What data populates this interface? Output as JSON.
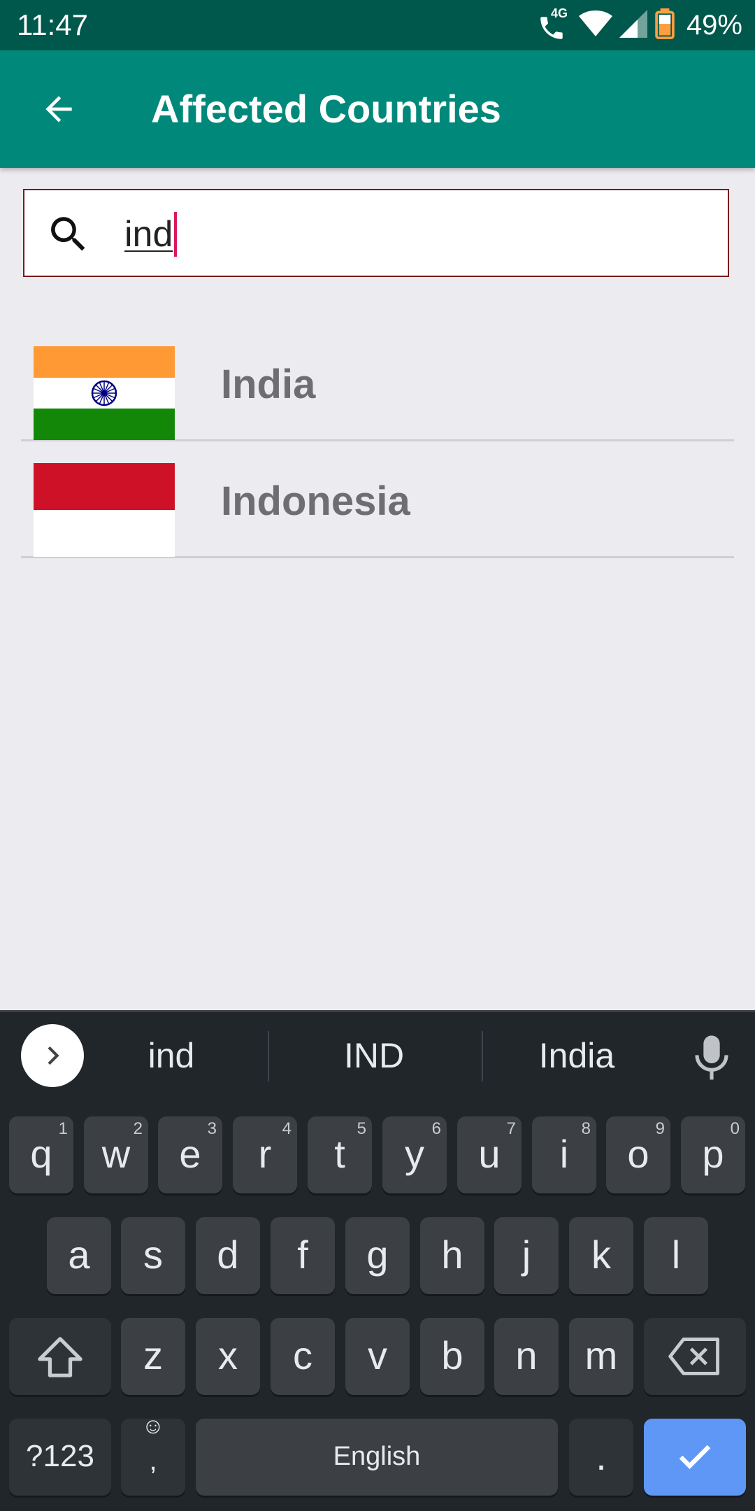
{
  "status_bar": {
    "time": "11:47",
    "network_label": "4G",
    "battery": "49%"
  },
  "app_bar": {
    "title": "Affected Countries",
    "back_icon": "arrow-left-icon"
  },
  "search": {
    "value": "ind",
    "icon": "search-icon"
  },
  "countries": [
    {
      "name": "India",
      "flag": "india-flag"
    },
    {
      "name": "Indonesia",
      "flag": "indonesia-flag"
    }
  ],
  "keyboard": {
    "suggestions": [
      "ind",
      "IND",
      "India"
    ],
    "row1": [
      {
        "key": "q",
        "hint": "1"
      },
      {
        "key": "w",
        "hint": "2"
      },
      {
        "key": "e",
        "hint": "3"
      },
      {
        "key": "r",
        "hint": "4"
      },
      {
        "key": "t",
        "hint": "5"
      },
      {
        "key": "y",
        "hint": "6"
      },
      {
        "key": "u",
        "hint": "7"
      },
      {
        "key": "i",
        "hint": "8"
      },
      {
        "key": "o",
        "hint": "9"
      },
      {
        "key": "p",
        "hint": "0"
      }
    ],
    "row2": [
      "a",
      "s",
      "d",
      "f",
      "g",
      "h",
      "j",
      "k",
      "l"
    ],
    "row3": [
      "z",
      "x",
      "c",
      "v",
      "b",
      "n",
      "m"
    ],
    "symbols_label": "?123",
    "comma_label": ",",
    "space_label": "English",
    "period_label": "."
  },
  "colors": {
    "status_bar": "#00574B",
    "app_bar": "#00897B",
    "accent_caret": "#D81B60",
    "keyboard_bg": "#21262B",
    "enter_key": "#5E97F6"
  }
}
